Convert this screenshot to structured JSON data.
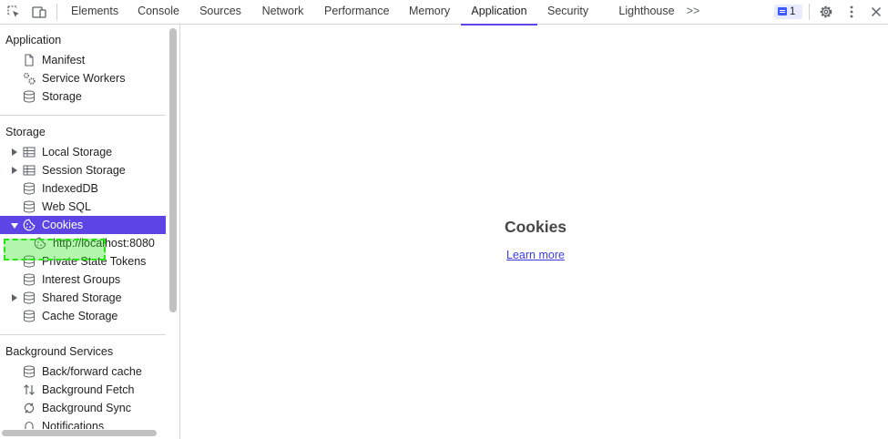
{
  "toolbar": {
    "tabs": [
      {
        "label": "Elements"
      },
      {
        "label": "Console"
      },
      {
        "label": "Sources"
      },
      {
        "label": "Network"
      },
      {
        "label": "Performance"
      },
      {
        "label": "Memory"
      },
      {
        "label": "Application",
        "active": true
      },
      {
        "label": "Security"
      },
      {
        "label": "Lighthouse"
      }
    ],
    "more_tabs_icon": ">>",
    "issues_count": "1",
    "accent_color": "#5b46e5"
  },
  "sidebar": {
    "application": {
      "title": "Application",
      "items": [
        {
          "label": "Manifest",
          "icon": "document-icon"
        },
        {
          "label": "Service Workers",
          "icon": "gears-icon"
        },
        {
          "label": "Storage",
          "icon": "database-icon"
        }
      ]
    },
    "storage": {
      "title": "Storage",
      "items": [
        {
          "label": "Local Storage",
          "icon": "table-icon"
        },
        {
          "label": "Session Storage",
          "icon": "table-icon"
        },
        {
          "label": "IndexedDB",
          "icon": "database-icon"
        },
        {
          "label": "Web SQL",
          "icon": "database-icon"
        },
        {
          "label": "Cookies",
          "icon": "cookie-icon"
        },
        {
          "label": "http://localhost:8080",
          "icon": "cookie-icon"
        },
        {
          "label": "Private State Tokens",
          "icon": "database-icon"
        },
        {
          "label": "Interest Groups",
          "icon": "database-icon"
        },
        {
          "label": "Shared Storage",
          "icon": "database-icon"
        },
        {
          "label": "Cache Storage",
          "icon": "database-icon"
        }
      ]
    },
    "background": {
      "title": "Background Services",
      "items": [
        {
          "label": "Back/forward cache",
          "icon": "database-icon"
        },
        {
          "label": "Background Fetch",
          "icon": "up-down-arrows-icon"
        },
        {
          "label": "Background Sync",
          "icon": "sync-icon"
        },
        {
          "label": "Notifications",
          "icon": "bell-icon"
        }
      ]
    }
  },
  "main": {
    "title": "Cookies",
    "link": "Learn more"
  }
}
